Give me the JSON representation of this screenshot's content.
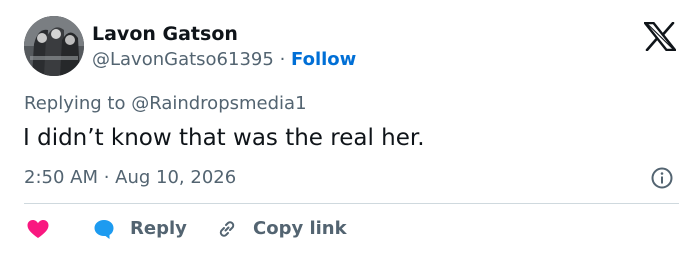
{
  "author": {
    "name": "Lavon Gatson",
    "handle": "@LavonGatso61395",
    "separator": "·",
    "follow_label": "Follow"
  },
  "reply_context": {
    "prefix": "Replying to ",
    "handle": "@Raindropsmedia1"
  },
  "tweet": {
    "text": "I didn’t know that was the real her.",
    "timestamp": "2:50 AM · Aug 10, 2026"
  },
  "actions": {
    "reply_label": "Reply",
    "copy_label": "Copy link"
  },
  "icons": {
    "logo": "x-logo-icon",
    "info": "info-icon",
    "like": "heart-icon",
    "reply": "speech-bubble-icon",
    "copy": "link-icon"
  },
  "colors": {
    "text": "#0f1419",
    "secondary": "#536471",
    "link": "#006fd6",
    "like": "#f91880",
    "reply": "#1d9bf0",
    "divider": "#cfd9de"
  }
}
